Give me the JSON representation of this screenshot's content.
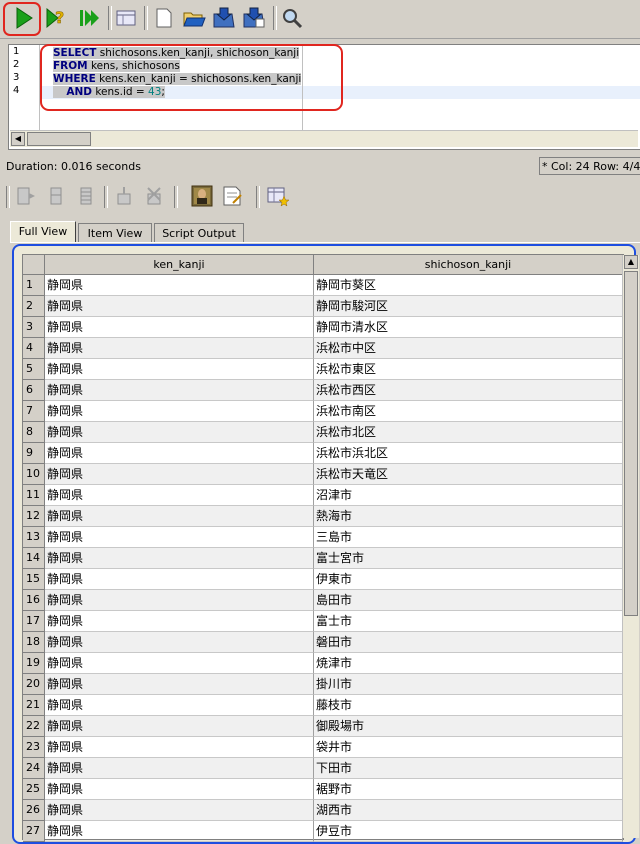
{
  "toolbar": {
    "buttons": [
      "run-icon",
      "run-script-icon",
      "step-icon",
      "explain-icon",
      "new-file-icon",
      "open-file-icon",
      "save-icon",
      "save-as-icon",
      "search-icon"
    ]
  },
  "editor": {
    "line_numbers": [
      "1",
      "2",
      "3",
      "4"
    ],
    "lines": [
      {
        "kw": "SELECT",
        "rest": " shichosons.ken_kanji, shichoson_kanji"
      },
      {
        "kw": "FROM",
        "rest": " kens, shichosons"
      },
      {
        "kw": "WHERE",
        "rest": " kens.ken_kanji = shichosons.ken_kanji"
      },
      {
        "indent": "    ",
        "kw": "AND",
        "rest": " kens.id = ",
        "num": "43",
        "end": ";"
      }
    ]
  },
  "status": {
    "duration": "Duration: 0.016 seconds",
    "position": "* Col: 24  Row: 4/4"
  },
  "tabs": [
    "Full View",
    "Item View",
    "Script Output"
  ],
  "grid": {
    "columns": [
      "ken_kanji",
      "shichoson_kanji"
    ],
    "rows": [
      [
        "1",
        "静岡県",
        "静岡市葵区"
      ],
      [
        "2",
        "静岡県",
        "静岡市駿河区"
      ],
      [
        "3",
        "静岡県",
        "静岡市清水区"
      ],
      [
        "4",
        "静岡県",
        "浜松市中区"
      ],
      [
        "5",
        "静岡県",
        "浜松市東区"
      ],
      [
        "6",
        "静岡県",
        "浜松市西区"
      ],
      [
        "7",
        "静岡県",
        "浜松市南区"
      ],
      [
        "8",
        "静岡県",
        "浜松市北区"
      ],
      [
        "9",
        "静岡県",
        "浜松市浜北区"
      ],
      [
        "10",
        "静岡県",
        "浜松市天竜区"
      ],
      [
        "11",
        "静岡県",
        "沼津市"
      ],
      [
        "12",
        "静岡県",
        "熱海市"
      ],
      [
        "13",
        "静岡県",
        "三島市"
      ],
      [
        "14",
        "静岡県",
        "富士宮市"
      ],
      [
        "15",
        "静岡県",
        "伊東市"
      ],
      [
        "16",
        "静岡県",
        "島田市"
      ],
      [
        "17",
        "静岡県",
        "富士市"
      ],
      [
        "18",
        "静岡県",
        "磐田市"
      ],
      [
        "19",
        "静岡県",
        "焼津市"
      ],
      [
        "20",
        "静岡県",
        "掛川市"
      ],
      [
        "21",
        "静岡県",
        "藤枝市"
      ],
      [
        "22",
        "静岡県",
        "御殿場市"
      ],
      [
        "23",
        "静岡県",
        "袋井市"
      ],
      [
        "24",
        "静岡県",
        "下田市"
      ],
      [
        "25",
        "静岡県",
        "裾野市"
      ],
      [
        "26",
        "静岡県",
        "湖西市"
      ],
      [
        "27",
        "静岡県",
        "伊豆市"
      ]
    ]
  },
  "colors": {
    "highlight_red": "#e0261f",
    "highlight_blue": "#1e4ee0",
    "keyword": "#00007f",
    "number": "#008080"
  }
}
